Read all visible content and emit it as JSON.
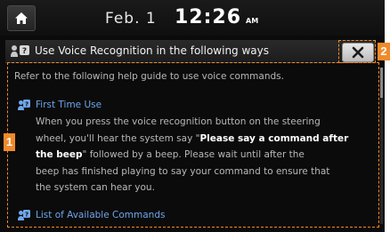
{
  "status_bar": {
    "date": "Feb.  1",
    "time": "12:26",
    "ampm": "AM"
  },
  "header": {
    "title": "Use Voice Recognition in the following ways"
  },
  "content": {
    "intro": "Refer to the following help guide to use voice commands.",
    "sections": [
      {
        "title": "First Time Use",
        "lines": [
          {
            "parts": [
              "When you press the voice recognition button on the steering"
            ]
          },
          {
            "parts": [
              "wheel, you'll hear the system say \"",
              "Please say a command after",
              ""
            ]
          },
          {
            "parts": [
              "",
              "the beep",
              "\" followed by a beep. Please wait until after the"
            ]
          },
          {
            "parts": [
              "beep has finished playing to say your command to ensure that"
            ]
          },
          {
            "parts": [
              "the system can hear you."
            ]
          }
        ]
      },
      {
        "title": "List of Available Commands"
      }
    ]
  },
  "callouts": {
    "content_area": "1",
    "close_button": "2"
  },
  "colors": {
    "callout": "#f08a2a",
    "link": "#6fa6ea"
  }
}
